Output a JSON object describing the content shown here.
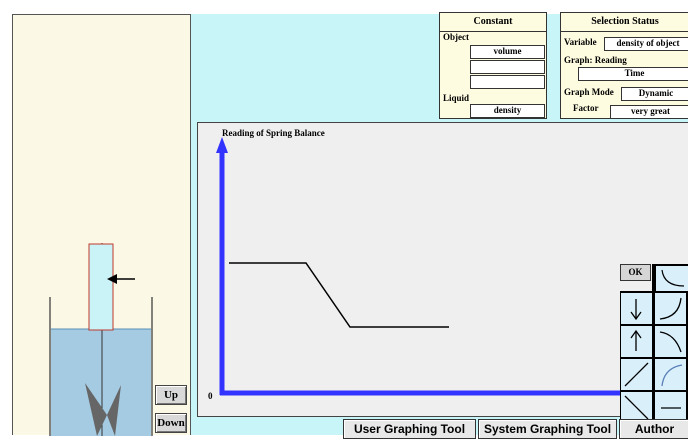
{
  "controls": {
    "up_label": "Up",
    "down_label": "Down"
  },
  "constant": {
    "title": "Constant",
    "object_label": "Object",
    "object_fields": [
      "volume",
      "",
      ""
    ],
    "liquid_label": "Liquid",
    "liquid_field": "density"
  },
  "status": {
    "title": "Selection Status",
    "variable_label": "Variable",
    "variable_value": "density of object",
    "graph_reading_label": "Graph: Reading",
    "graph_reading_value": "Time",
    "graph_mode_label": "Graph Mode",
    "graph_mode_value": "Dynamic",
    "factor_label": "Factor",
    "factor_value": "very great"
  },
  "graph": {
    "title": "Reading of Spring Balance",
    "origin_label": "0",
    "axis_color": "#3333ff",
    "line_color": "#000000"
  },
  "palette": {
    "ok_label": "OK",
    "tools": [
      "concave-decreasing-curve-icon",
      "down-arrow-icon",
      "convex-increasing-curve-icon",
      "up-arrow-icon",
      "concave-decreasing-curve-2-icon",
      "increasing-line-icon",
      "concave-increasing-curve-icon",
      "decreasing-line-icon",
      "horizontal-line-icon"
    ]
  },
  "bottom_buttons": {
    "user": "User Graphing Tool",
    "system": "System Graphing Tool",
    "author": "Author"
  }
}
